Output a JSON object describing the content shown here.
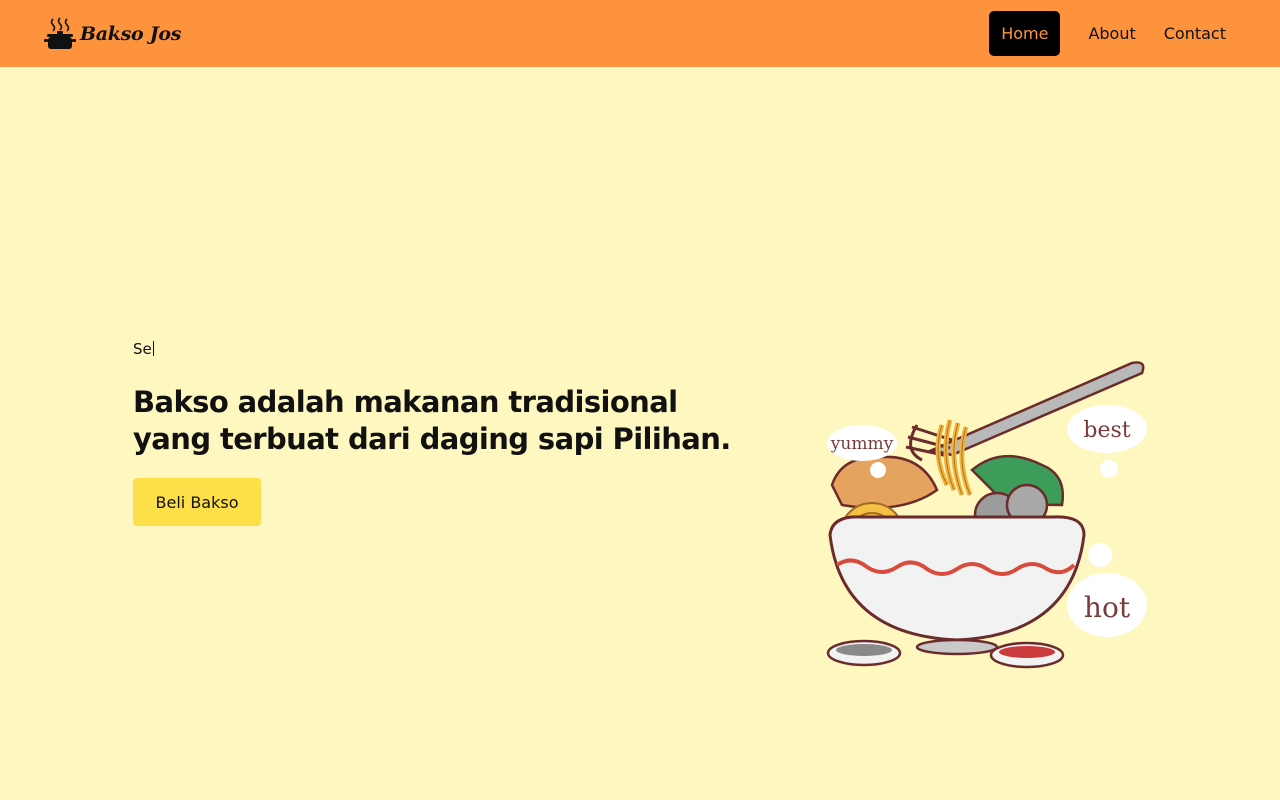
{
  "navbar": {
    "brand": "Bakso Jos",
    "links": [
      {
        "label": "Home",
        "active": true
      },
      {
        "label": "About",
        "active": false
      },
      {
        "label": "Contact",
        "active": false
      }
    ]
  },
  "hero": {
    "typing_text": "Se",
    "headline_line1": "Bakso adalah makanan tradisional",
    "headline_line2": "yang terbuat dari daging sapi Pilihan.",
    "cta_label": "Beli Bakso"
  },
  "illustration": {
    "bubbles": [
      "yummy",
      "best",
      "hot"
    ]
  },
  "colors": {
    "navbar": "#fd943d",
    "background": "#fef8c0",
    "active_link_bg": "#000000",
    "button": "#fddf4a"
  }
}
